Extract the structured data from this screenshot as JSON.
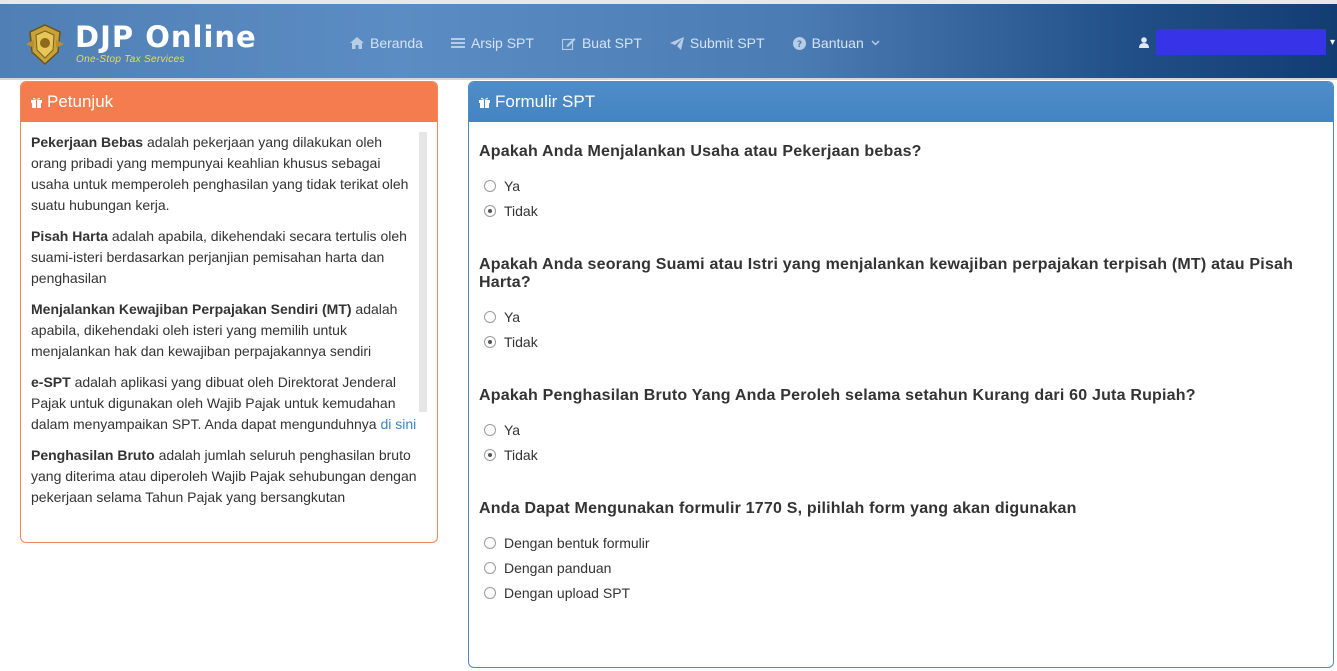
{
  "header": {
    "brand_title": "DJP Online",
    "brand_subtitle": "One-Stop Tax Services",
    "nav": [
      {
        "label": "Beranda",
        "icon": "home-icon"
      },
      {
        "label": "Arsip SPT",
        "icon": "list-icon"
      },
      {
        "label": "Buat SPT",
        "icon": "edit-icon"
      },
      {
        "label": "Submit SPT",
        "icon": "send-icon"
      },
      {
        "label": "Bantuan",
        "icon": "help-circle-icon"
      }
    ],
    "user_icon": "user-icon"
  },
  "help_panel": {
    "title": "Petunjuk",
    "items": [
      {
        "term": "Pekerjaan Bebas",
        "text": " adalah pekerjaan yang dilakukan oleh orang pribadi yang mempunyai keahlian khusus sebagai usaha untuk memperoleh penghasilan yang tidak terikat oleh suatu hubungan kerja."
      },
      {
        "term": "Pisah Harta",
        "text": " adalah apabila, dikehendaki secara tertulis oleh suami-isteri berdasarkan perjanjian pemisahan harta dan penghasilan"
      },
      {
        "term": "Menjalankan Kewajiban Perpajakan Sendiri (MT)",
        "text": " adalah apabila, dikehendaki oleh isteri yang memilih untuk menjalankan hak dan kewajiban perpajakannya sendiri"
      },
      {
        "term": "e-SPT",
        "text": " adalah aplikasi yang dibuat oleh Direktorat Jenderal Pajak untuk digunakan oleh Wajib Pajak untuk kemudahan dalam menyampaikan SPT. Anda dapat mengunduhnya ",
        "link": "di sini"
      },
      {
        "term": "Penghasilan Bruto",
        "text": " adalah jumlah seluruh penghasilan bruto yang diterima atau diperoleh Wajib Pajak sehubungan dengan pekerjaan selama Tahun Pajak yang bersangkutan"
      }
    ]
  },
  "form_panel": {
    "title": "Formulir SPT",
    "questions": [
      {
        "question": "Apakah Anda Menjalankan Usaha atau Pekerjaan bebas?",
        "options": [
          "Ya",
          "Tidak"
        ],
        "selected": 1
      },
      {
        "question": "Apakah Anda seorang Suami atau Istri yang menjalankan kewajiban perpajakan terpisah (MT) atau Pisah Harta?",
        "options": [
          "Ya",
          "Tidak"
        ],
        "selected": 1
      },
      {
        "question": "Apakah Penghasilan Bruto Yang Anda Peroleh selama setahun Kurang dari 60 Juta Rupiah?",
        "options": [
          "Ya",
          "Tidak"
        ],
        "selected": 1
      },
      {
        "question": "Anda Dapat Mengunakan formulir 1770 S, pilihlah form yang akan digunakan",
        "options": [
          "Dengan bentuk formulir",
          "Dengan panduan",
          "Dengan upload SPT"
        ],
        "selected": -1
      }
    ]
  },
  "colors": {
    "help_header": "#f47c4e",
    "form_header": "#4a88c5",
    "link": "#3b84c4",
    "user_box": "#3733e8"
  }
}
